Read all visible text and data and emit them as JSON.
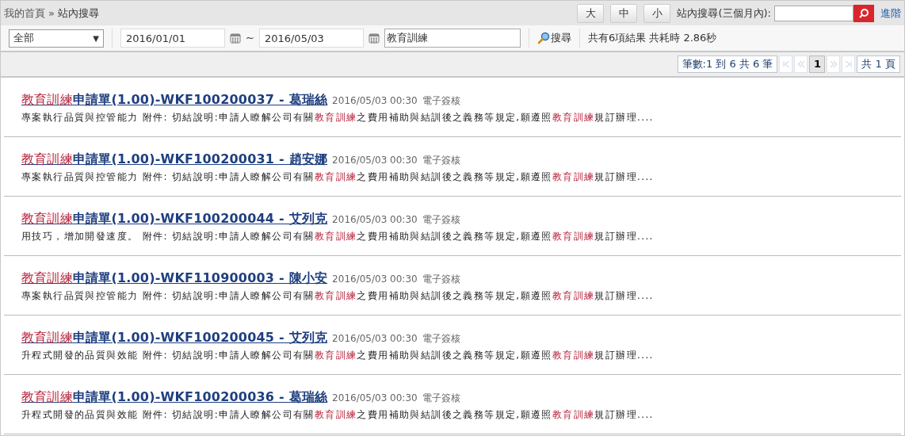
{
  "breadcrumb": {
    "home": "我的首頁",
    "separator": "»",
    "current": "站內搜尋"
  },
  "font_size_buttons": [
    "大",
    "中",
    "小"
  ],
  "quick_search": {
    "label": "站內搜尋(三個月內):",
    "advanced_link": "進階"
  },
  "filters": {
    "category": "全部",
    "dropdown_arrow": "▼",
    "date_from": "2016/01/01",
    "range_separator": "~",
    "date_to": "2016/05/03",
    "keyword": "教育訓練",
    "search_button": "搜尋",
    "summary": "共有6項結果 共耗時 2.86秒"
  },
  "pager": {
    "records": "筆數:1 到 6 共 6 筆",
    "pages": [
      {
        "label": "1",
        "selected": true
      }
    ],
    "total_pages": "共 1 頁"
  },
  "results": [
    {
      "title": [
        {
          "text": "教育訓練",
          "hit": true
        },
        {
          "text": "申請單(1.00)-WKF100200037 - 葛瑞絲",
          "hit": false
        }
      ],
      "time": "2016/05/03 00:30",
      "type": "電子簽核",
      "snippet": [
        {
          "text": "專案執行品質與控管能力 附件: 切結說明:申請人瞭解公司有關",
          "hit": false
        },
        {
          "text": "教育訓練",
          "hit": true
        },
        {
          "text": "之費用補助與結訓後之義務等規定,願遵照",
          "hit": false
        },
        {
          "text": "教育訓練",
          "hit": true
        },
        {
          "text": "規訂辦理....",
          "hit": false
        }
      ]
    },
    {
      "title": [
        {
          "text": "教育訓練",
          "hit": true
        },
        {
          "text": "申請單(1.00)-WKF100200031 - 趙安娜",
          "hit": false
        }
      ],
      "time": "2016/05/03 00:30",
      "type": "電子簽核",
      "snippet": [
        {
          "text": "專案執行品質與控管能力 附件: 切結說明:申請人瞭解公司有關",
          "hit": false
        },
        {
          "text": "教育訓練",
          "hit": true
        },
        {
          "text": "之費用補助與結訓後之義務等規定,願遵照",
          "hit": false
        },
        {
          "text": "教育訓練",
          "hit": true
        },
        {
          "text": "規訂辦理....",
          "hit": false
        }
      ]
    },
    {
      "title": [
        {
          "text": "教育訓練",
          "hit": true
        },
        {
          "text": "申請單(1.00)-WKF100200044 - 艾列克",
          "hit": false
        }
      ],
      "time": "2016/05/03 00:30",
      "type": "電子簽核",
      "snippet": [
        {
          "text": "用技巧，增加開發速度。 附件: 切結說明:申請人瞭解公司有關",
          "hit": false
        },
        {
          "text": "教育訓練",
          "hit": true
        },
        {
          "text": "之費用補助與結訓後之義務等規定,願遵照",
          "hit": false
        },
        {
          "text": "教育訓練",
          "hit": true
        },
        {
          "text": "規訂辦理....",
          "hit": false
        }
      ]
    },
    {
      "title": [
        {
          "text": "教育訓練",
          "hit": true
        },
        {
          "text": "申請單(1.00)-WKF110900003 - 陳小安",
          "hit": false
        }
      ],
      "time": "2016/05/03 00:30",
      "type": "電子簽核",
      "snippet": [
        {
          "text": "專案執行品質與控管能力 附件: 切結說明:申請人瞭解公司有關",
          "hit": false
        },
        {
          "text": "教育訓練",
          "hit": true
        },
        {
          "text": "之費用補助與結訓後之義務等規定,願遵照",
          "hit": false
        },
        {
          "text": "教育訓練",
          "hit": true
        },
        {
          "text": "規訂辦理....",
          "hit": false
        }
      ]
    },
    {
      "title": [
        {
          "text": "教育訓練",
          "hit": true
        },
        {
          "text": "申請單(1.00)-WKF100200045 - 艾列克",
          "hit": false
        }
      ],
      "time": "2016/05/03 00:30",
      "type": "電子簽核",
      "snippet": [
        {
          "text": "升程式開發的品質與效能 附件: 切結說明:申請人瞭解公司有關",
          "hit": false
        },
        {
          "text": "教育訓練",
          "hit": true
        },
        {
          "text": "之費用補助與結訓後之義務等規定,願遵照",
          "hit": false
        },
        {
          "text": "教育訓練",
          "hit": true
        },
        {
          "text": "規訂辦理....",
          "hit": false
        }
      ]
    },
    {
      "title": [
        {
          "text": "教育訓練",
          "hit": true
        },
        {
          "text": "申請單(1.00)-WKF100200036 - 葛瑞絲",
          "hit": false
        }
      ],
      "time": "2016/05/03 00:30",
      "type": "電子簽核",
      "snippet": [
        {
          "text": "升程式開發的品質與效能 附件: 切結說明:申請人瞭解公司有關",
          "hit": false
        },
        {
          "text": "教育訓練",
          "hit": true
        },
        {
          "text": "之費用補助與結訓後之義務等規定,願遵照",
          "hit": false
        },
        {
          "text": "教育訓練",
          "hit": true
        },
        {
          "text": "規訂辦理....",
          "hit": false
        }
      ]
    }
  ]
}
